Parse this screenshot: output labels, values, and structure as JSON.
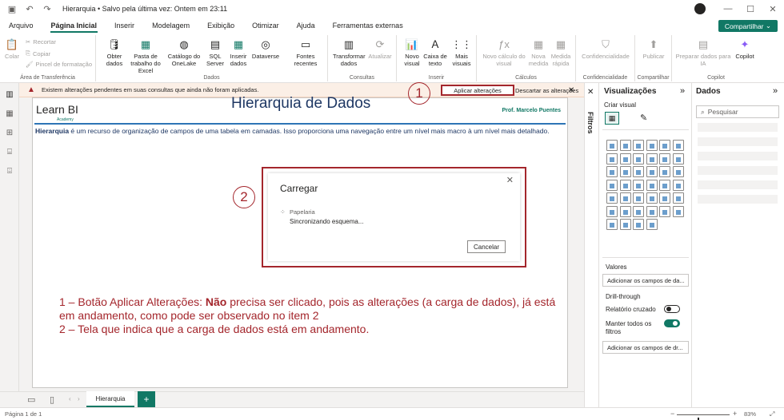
{
  "window": {
    "title": "Hierarquia • Salvo pela última vez: Ontem em 23:11"
  },
  "ribbon_tabs": [
    "Arquivo",
    "Página Inicial",
    "Inserir",
    "Modelagem",
    "Exibição",
    "Otimizar",
    "Ajuda",
    "Ferramentas externas"
  ],
  "share_button": "Compartilhar",
  "ribbon": {
    "clipboard": {
      "paste": "Colar",
      "cut": "Recortar",
      "copy": "Copiar",
      "format_painter": "Pincel de formatação",
      "label": "Área de Transferência"
    },
    "data": {
      "get_data": "Obter dados",
      "excel": "Pasta de trabalho do Excel",
      "onelake": "Catálogo do OneLake",
      "sql": "SQL Server",
      "enter_data": "Inserir dados",
      "dataverse": "Dataverse",
      "recent": "Fontes recentes",
      "label": "Dados"
    },
    "queries": {
      "transform": "Transformar dados",
      "refresh": "Atualizar",
      "label": "Consultas"
    },
    "insert": {
      "new_visual": "Novo visual",
      "text_box": "Caixa de texto",
      "more_visuals": "Mais visuais",
      "label": "Inserir"
    },
    "calculations": {
      "new_calc": "Novo cálculo do visual",
      "new_measure": "Nova medida",
      "quick_measure": "Medida rápida",
      "label": "Cálculos"
    },
    "sensitivity": {
      "button": "Confidencialidade",
      "label": "Confidencialidade"
    },
    "share": {
      "publish": "Publicar",
      "label": "Compartilhar"
    },
    "copilot": {
      "prepare": "Preparar dados para IA",
      "copilot": "Copilot",
      "label": "Copilot"
    }
  },
  "warning": {
    "message": "Existem alterações pendentes em suas consultas que ainda não foram aplicadas.",
    "apply": "Aplicar alterações",
    "discard": "Descartar as alterações"
  },
  "report": {
    "logo": "Learn BI",
    "logo_sub": "Academy",
    "title": "Hierarquia de Dados",
    "author": "Prof. Marcelo Puentes",
    "intro_bold": "Hierarquia",
    "intro_rest": " é um recurso de organização de campos de uma tabela em camadas. Isso proporciona uma navegação entre um nível mais macro à um nível mais detalhado."
  },
  "callouts": [
    "1",
    "2"
  ],
  "dialog": {
    "title": "Carregar",
    "source": "Papelaria",
    "status": "Sincronizando esquema...",
    "cancel": "Cancelar"
  },
  "annotation": {
    "line1_a": "1 – Botão Aplicar Alterações: ",
    "line1_bold": "Não",
    "line1_b": " precisa ser clicado, pois as alterações (a carga de dados), já está em andamento, como pode ser observado no item 2",
    "line2": "2 – Tela que indica que a carga de dados está em andamento."
  },
  "filters_label": "Filtros",
  "visualizations": {
    "title": "Visualizações",
    "build": "Criar visual",
    "values": "Valores",
    "add_fields": "Adicionar os campos de da...",
    "drillthrough": "Drill-through",
    "cross_report": "Relatório cruzado",
    "cross_report_state": "Desativado",
    "keep_filters": "Manter todos os filtros",
    "keep_filters_state": "Ativado",
    "add_fields_drill": "Adicionar os campos de dr..."
  },
  "data_pane": {
    "title": "Dados",
    "search_placeholder": "Pesquisar"
  },
  "page_tab": "Hierarquia",
  "status": {
    "page": "Página 1 de 1",
    "zoom": "83%"
  },
  "colors": {
    "accent": "#117865",
    "annotation": "#a4262c",
    "title": "#1f3864"
  }
}
